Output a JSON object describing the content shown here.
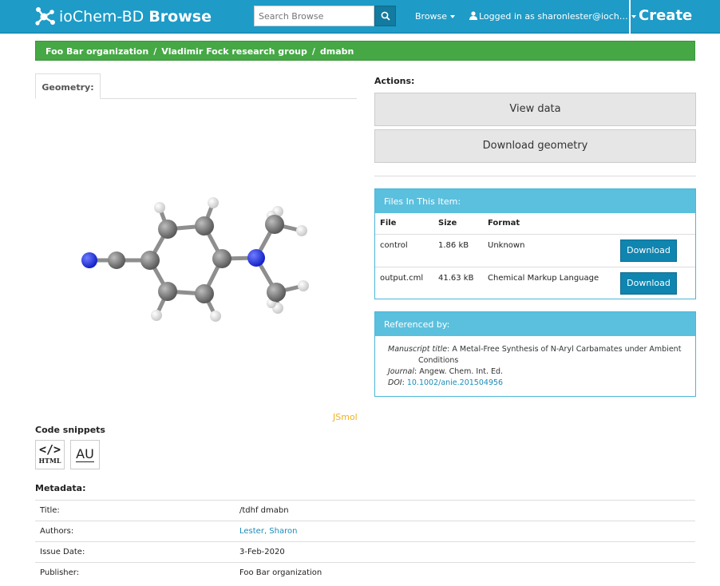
{
  "navbar": {
    "brand_prefix": "ioChem-BD",
    "brand_bold": "Browse",
    "search_placeholder": "Search Browse",
    "browse_label": "Browse",
    "user_label": "Logged in as sharonlester@ioch…",
    "create_label": "Create",
    "color": "#1e9bc7"
  },
  "breadcrumb": {
    "items": [
      "Foo Bar organization",
      "Vladimir Fock research group",
      "dmabn"
    ],
    "separator": "/",
    "color": "#45a845"
  },
  "geometry": {
    "tab_label": "Geometry:",
    "viewer_label": "JSmol"
  },
  "actions": {
    "heading": "Actions:",
    "view_data": "View data",
    "download_geometry": "Download geometry"
  },
  "files": {
    "heading": "Files In This Item:",
    "columns": [
      "File",
      "Size",
      "Format"
    ],
    "rows": [
      {
        "file": "control",
        "size": "1.86 kB",
        "format": "Unknown",
        "action": "Download"
      },
      {
        "file": "output.cml",
        "size": "41.63 kB",
        "format": "Chemical Markup Language",
        "action": "Download"
      }
    ]
  },
  "referenced": {
    "heading": "Referenced by:",
    "manuscript_label": "Manuscript title",
    "manuscript_value": "A Metal-Free Synthesis of N-Aryl Carbamates under Ambient",
    "manuscript_cont": "Conditions",
    "journal_label": "Journal",
    "journal_value": "Angew. Chem. Int. Ed.",
    "doi_label": "DOI",
    "doi_value": "10.1002/anie.201504956"
  },
  "snippets": {
    "heading": "Code snippets",
    "html_code": "</>",
    "html_label": "HTML",
    "au_label": "AU"
  },
  "metadata": {
    "heading": "Metadata:",
    "rows": [
      {
        "key": "Title:",
        "value": "/tdhf dmabn"
      },
      {
        "key": "Authors:",
        "value": "Lester, Sharon"
      },
      {
        "key": "Issue Date:",
        "value": "3-Feb-2020"
      },
      {
        "key": "Publisher:",
        "value": "Foo Bar organization"
      }
    ]
  }
}
